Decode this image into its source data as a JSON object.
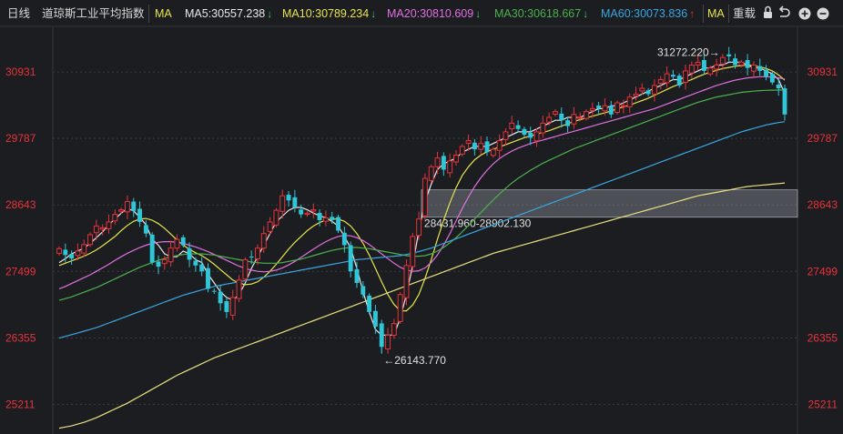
{
  "header": {
    "period": "日线",
    "index_name": "道琼斯工业平均指数",
    "ma_button": "MA",
    "ma_values": [
      {
        "text": "MA5:30557.238",
        "trend": "down",
        "color": "#e8e8e8"
      },
      {
        "text": "MA10:30789.234",
        "trend": "down",
        "color": "#e6e44a"
      },
      {
        "text": "MA20:30810.609",
        "trend": "down",
        "color": "#e070e0"
      },
      {
        "text": "MA30:30618.667",
        "trend": "down",
        "color": "#4cb04c"
      },
      {
        "text": "MA60:30073.836",
        "trend": "up",
        "color": "#3aa6e0"
      }
    ],
    "ma_button2": "MA",
    "reweight_label": "重载",
    "icons": [
      "lock-icon",
      "return-icon",
      "zoom-in-icon",
      "zoom-out-icon"
    ]
  },
  "colors": {
    "background": "#1c1d21",
    "up": "#e8323a",
    "down": "#2fc6d8",
    "axis_text": "#e8323a",
    "annotation": "#e0e0e0",
    "band_fill": "#8a8f96"
  },
  "chart_data": {
    "type": "candlestick",
    "title": "道琼斯工业平均指数",
    "period": "daily",
    "ylim": [
      24700,
      31700
    ],
    "y_ticks": [
      25211,
      26355,
      27499,
      28643,
      29787,
      30931
    ],
    "grid": true,
    "annotations": {
      "high": {
        "label": "31272.220",
        "value": 31272.22,
        "index": 108
      },
      "low": {
        "label": "26143.770",
        "value": 26143.77,
        "index": 52
      },
      "band": {
        "label": "28431.960-28902.130",
        "low": 28431.96,
        "high": 28902.13,
        "from_index": 59
      }
    },
    "ma_legend": [
      "MA5",
      "MA10",
      "MA20",
      "MA30",
      "MA60",
      "MA250"
    ],
    "ma_colors": {
      "MA5": "#e8e8e8",
      "MA10": "#e6e44a",
      "MA20": "#e070e0",
      "MA30": "#4cb04c",
      "MA60": "#3aa6e0",
      "MA250": "#e8e080"
    },
    "closes": [
      27890,
      27780,
      27720,
      27850,
      27960,
      28130,
      28280,
      28250,
      28350,
      28480,
      28560,
      28700,
      28540,
      28350,
      28150,
      27650,
      27580,
      27700,
      27900,
      28050,
      27950,
      27700,
      27600,
      27500,
      27200,
      27150,
      26950,
      26800,
      27050,
      27350,
      27700,
      27750,
      27900,
      28150,
      28350,
      28550,
      28800,
      28720,
      28600,
      28480,
      28500,
      28560,
      28380,
      28420,
      28380,
      28200,
      27950,
      27500,
      27300,
      27100,
      26800,
      26550,
      26200,
      26400,
      26600,
      27100,
      27600,
      28100,
      28400,
      29100,
      29300,
      29450,
      29250,
      29400,
      29500,
      29650,
      29750,
      29600,
      29700,
      29550,
      29600,
      29750,
      29900,
      30050,
      29950,
      29850,
      29800,
      29900,
      30050,
      30150,
      30250,
      30100,
      30000,
      30200,
      30150,
      30250,
      30300,
      30300,
      30350,
      30200,
      30400,
      30350,
      30500,
      30550,
      30650,
      30550,
      30700,
      30800,
      30900,
      30850,
      30700,
      30950,
      31050,
      31100,
      30950,
      31000,
      31050,
      31180,
      31200,
      31050,
      31100,
      31000,
      31050,
      30950,
      30850,
      30750,
      30650,
      30200
    ],
    "ma_lines": {
      "MA5": [
        27650,
        27720,
        27800,
        27850,
        27900,
        27980,
        28080,
        28180,
        28300,
        28400,
        28500,
        28580,
        28540,
        28430,
        28300,
        28050,
        27950,
        27800,
        27750,
        27750,
        27850,
        27800,
        27700,
        27650,
        27450,
        27300,
        27150,
        27050,
        27000,
        27100,
        27300,
        27550,
        27750,
        27950,
        28150,
        28350,
        28450,
        28550,
        28600,
        28600,
        28560,
        28500,
        28460,
        28420,
        28360,
        28280,
        28100,
        27900,
        27550,
        27150,
        26800,
        26500,
        26400,
        26400,
        26400,
        26700,
        27100,
        27600,
        28200,
        28700,
        29000,
        29250,
        29350,
        29400,
        29450,
        29550,
        29600,
        29650,
        29650,
        29650,
        29700,
        29750,
        29800,
        29850,
        29900,
        29900,
        29900,
        29950,
        30000,
        30050,
        30100,
        30100,
        30150,
        30150,
        30150,
        30200,
        30250,
        30300,
        30300,
        30350,
        30350,
        30400,
        30450,
        30500,
        30550,
        30600,
        30650,
        30700,
        30750,
        30800,
        30800,
        30850,
        30900,
        30950,
        31000,
        31000,
        31050,
        31050,
        31100,
        31100,
        31100,
        31050,
        31000,
        31000,
        30950,
        30900,
        30800,
        30560
      ],
      "MA10": [
        27600,
        27640,
        27680,
        27720,
        27760,
        27810,
        27870,
        27940,
        28020,
        28100,
        28200,
        28290,
        28360,
        28400,
        28410,
        28380,
        28320,
        28240,
        28140,
        28040,
        27950,
        27880,
        27820,
        27770,
        27700,
        27620,
        27530,
        27440,
        27350,
        27300,
        27270,
        27280,
        27320,
        27400,
        27500,
        27620,
        27750,
        27880,
        28000,
        28100,
        28200,
        28280,
        28340,
        28380,
        28400,
        28400,
        28360,
        28280,
        28150,
        27980,
        27780,
        27550,
        27320,
        27100,
        26930,
        26820,
        26820,
        26920,
        27100,
        27380,
        27700,
        28050,
        28380,
        28680,
        28940,
        29150,
        29300,
        29420,
        29500,
        29560,
        29600,
        29640,
        29680,
        29720,
        29760,
        29800,
        29830,
        29860,
        29890,
        29920,
        29960,
        30000,
        30040,
        30080,
        30110,
        30140,
        30170,
        30200,
        30230,
        30260,
        30300,
        30330,
        30360,
        30400,
        30440,
        30480,
        30530,
        30580,
        30630,
        30680,
        30720,
        30760,
        30800,
        30850,
        30890,
        30930,
        30960,
        30990,
        31010,
        31030,
        31040,
        31050,
        31040,
        31020,
        30990,
        30950,
        30880,
        30790
      ],
      "MA20": [
        27200,
        27240,
        27290,
        27340,
        27390,
        27440,
        27500,
        27560,
        27620,
        27690,
        27750,
        27810,
        27860,
        27910,
        27950,
        27980,
        28000,
        28010,
        28010,
        28000,
        27980,
        27950,
        27920,
        27880,
        27840,
        27790,
        27740,
        27690,
        27640,
        27590,
        27550,
        27520,
        27500,
        27490,
        27500,
        27520,
        27560,
        27610,
        27670,
        27740,
        27810,
        27880,
        27950,
        28010,
        28060,
        28100,
        28120,
        28110,
        28080,
        28030,
        27960,
        27880,
        27800,
        27720,
        27640,
        27570,
        27520,
        27500,
        27510,
        27560,
        27650,
        27780,
        27950,
        28150,
        28370,
        28580,
        28780,
        28960,
        29110,
        29240,
        29350,
        29440,
        29510,
        29570,
        29620,
        29660,
        29700,
        29730,
        29760,
        29790,
        29820,
        29850,
        29880,
        29910,
        29940,
        29970,
        30000,
        30030,
        30060,
        30090,
        30120,
        30150,
        30180,
        30210,
        30240,
        30270,
        30300,
        30340,
        30380,
        30420,
        30460,
        30500,
        30540,
        30580,
        30620,
        30660,
        30700,
        30730,
        30760,
        30790,
        30810,
        30830,
        30840,
        30850,
        30850,
        30840,
        30830,
        30810
      ],
      "MA30": [
        27000,
        27030,
        27060,
        27100,
        27140,
        27180,
        27220,
        27270,
        27320,
        27370,
        27420,
        27470,
        27520,
        27570,
        27610,
        27650,
        27690,
        27720,
        27750,
        27770,
        27790,
        27800,
        27800,
        27800,
        27790,
        27780,
        27760,
        27740,
        27720,
        27700,
        27680,
        27660,
        27650,
        27640,
        27640,
        27640,
        27650,
        27670,
        27690,
        27710,
        27740,
        27770,
        27800,
        27830,
        27860,
        27880,
        27900,
        27910,
        27910,
        27900,
        27890,
        27870,
        27850,
        27830,
        27810,
        27790,
        27770,
        27760,
        27760,
        27770,
        27800,
        27850,
        27910,
        27990,
        28080,
        28180,
        28290,
        28400,
        28510,
        28620,
        28730,
        28830,
        28930,
        29020,
        29100,
        29170,
        29240,
        29300,
        29360,
        29410,
        29460,
        29510,
        29560,
        29610,
        29650,
        29690,
        29730,
        29770,
        29810,
        29850,
        29890,
        29930,
        29970,
        30010,
        30050,
        30090,
        30130,
        30170,
        30210,
        30250,
        30290,
        30330,
        30370,
        30410,
        30440,
        30470,
        30500,
        30520,
        30540,
        30560,
        30580,
        30590,
        30600,
        30610,
        30615,
        30618,
        30620,
        30619
      ],
      "MA60": [
        26350,
        26380,
        26410,
        26440,
        26470,
        26500,
        26530,
        26570,
        26610,
        26650,
        26690,
        26730,
        26770,
        26810,
        26850,
        26890,
        26930,
        26970,
        27010,
        27050,
        27090,
        27120,
        27150,
        27180,
        27210,
        27240,
        27260,
        27280,
        27300,
        27320,
        27340,
        27360,
        27380,
        27400,
        27420,
        27440,
        27460,
        27480,
        27500,
        27520,
        27540,
        27560,
        27580,
        27600,
        27620,
        27640,
        27660,
        27680,
        27700,
        27710,
        27720,
        27730,
        27740,
        27750,
        27760,
        27770,
        27790,
        27810,
        27840,
        27870,
        27900,
        27940,
        27980,
        28020,
        28060,
        28100,
        28140,
        28180,
        28220,
        28260,
        28300,
        28340,
        28380,
        28420,
        28460,
        28500,
        28540,
        28580,
        28620,
        28660,
        28700,
        28740,
        28780,
        28820,
        28860,
        28900,
        28940,
        28980,
        29020,
        29060,
        29100,
        29140,
        29180,
        29220,
        29260,
        29300,
        29340,
        29380,
        29420,
        29460,
        29500,
        29540,
        29580,
        29620,
        29660,
        29700,
        29740,
        29780,
        29820,
        29860,
        29900,
        29930,
        29960,
        29990,
        30020,
        30040,
        30060,
        30074
      ],
      "MA250": [
        24800,
        24820,
        24840,
        24870,
        24900,
        24940,
        24980,
        25030,
        25080,
        25130,
        25180,
        25230,
        25290,
        25350,
        25410,
        25470,
        25530,
        25590,
        25650,
        25710,
        25760,
        25810,
        25860,
        25910,
        25960,
        26010,
        26050,
        26090,
        26130,
        26170,
        26210,
        26250,
        26290,
        26330,
        26370,
        26410,
        26450,
        26490,
        26530,
        26570,
        26610,
        26650,
        26690,
        26730,
        26770,
        26810,
        26850,
        26890,
        26930,
        26970,
        27010,
        27050,
        27090,
        27130,
        27170,
        27210,
        27250,
        27290,
        27330,
        27370,
        27410,
        27450,
        27490,
        27530,
        27570,
        27610,
        27650,
        27690,
        27730,
        27770,
        27810,
        27840,
        27870,
        27900,
        27930,
        27960,
        27990,
        28020,
        28050,
        28080,
        28110,
        28140,
        28170,
        28200,
        28230,
        28260,
        28290,
        28320,
        28350,
        28380,
        28410,
        28440,
        28470,
        28500,
        28530,
        28560,
        28590,
        28620,
        28650,
        28680,
        28710,
        28740,
        28770,
        28800,
        28820,
        28840,
        28860,
        28880,
        28900,
        28920,
        28940,
        28960,
        28970,
        28980,
        28990,
        29000,
        29010,
        29020
      ]
    }
  }
}
